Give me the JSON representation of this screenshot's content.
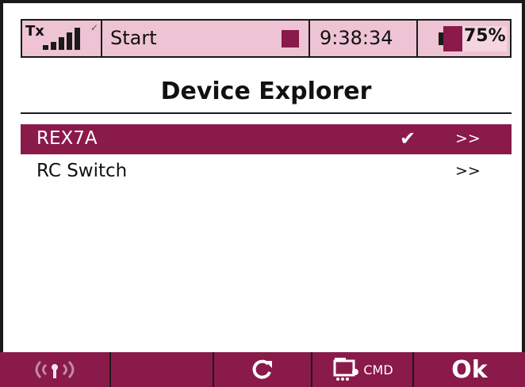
{
  "status_bar": {
    "tx_label": "Tx",
    "signal_icon": "signal-bars-icon",
    "mode_label": "Start",
    "stop_icon": "stop-square-icon",
    "time": "9:38:34",
    "battery_percent": "75%",
    "battery_level": 0.3
  },
  "screen": {
    "title": "Device Explorer"
  },
  "devices": [
    {
      "label": "REX7A",
      "checked": true,
      "arrow": ">>"
    },
    {
      "label": "RC Switch",
      "checked": false,
      "arrow": ">>"
    }
  ],
  "bottom_bar": {
    "buttons": [
      {
        "icon": "wireless-icon"
      },
      {
        "icon": ""
      },
      {
        "icon": "refresh-icon"
      },
      {
        "icon": "cmd-icon",
        "text": "CMD"
      },
      {
        "label": "Ok"
      }
    ]
  },
  "colors": {
    "accent": "#8a1a4a",
    "status_bg": "#eec3d3"
  }
}
